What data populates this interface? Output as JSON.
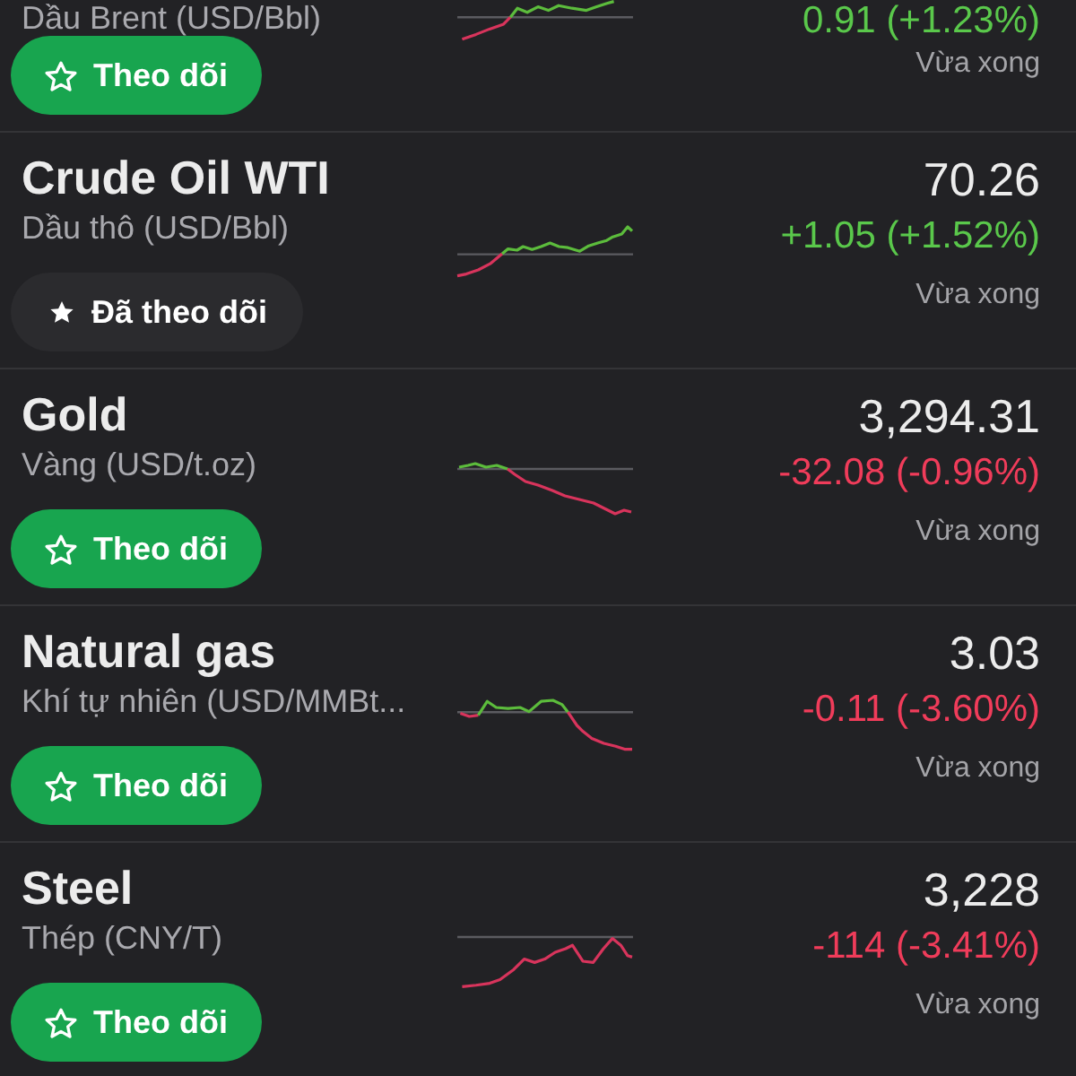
{
  "commodities": [
    {
      "subtitle": "Dầu Brent (USD/Bbl)",
      "change": "0.91 (+1.23%)",
      "rising": true,
      "updated": "Vừa xong",
      "follow": {
        "label": "Theo dõi",
        "followed": false
      }
    },
    {
      "name": "Crude Oil WTI",
      "subtitle": "Dầu thô (USD/Bbl)",
      "price": "70.26",
      "change": "+1.05 (+1.52%)",
      "rising": true,
      "updated": "Vừa xong",
      "follow": {
        "label": "Đã theo dõi",
        "followed": true
      }
    },
    {
      "name": "Gold",
      "subtitle": "Vàng (USD/t.oz)",
      "price": "3,294.31",
      "change": "-32.08 (-0.96%)",
      "rising": false,
      "updated": "Vừa xong",
      "follow": {
        "label": "Theo dõi",
        "followed": false
      }
    },
    {
      "name": "Natural gas",
      "subtitle": "Khí tự nhiên (USD/MMBt...",
      "price": "3.03",
      "change": "-0.11 (-3.60%)",
      "rising": false,
      "updated": "Vừa xong",
      "follow": {
        "label": "Theo dõi",
        "followed": false
      }
    },
    {
      "name": "Steel",
      "subtitle": "Thép (CNY/T)",
      "price": "3,228",
      "change": "-114 (-3.41%)",
      "rising": false,
      "updated": "Vừa xong",
      "follow": {
        "label": "Theo dõi",
        "followed": false
      }
    }
  ]
}
